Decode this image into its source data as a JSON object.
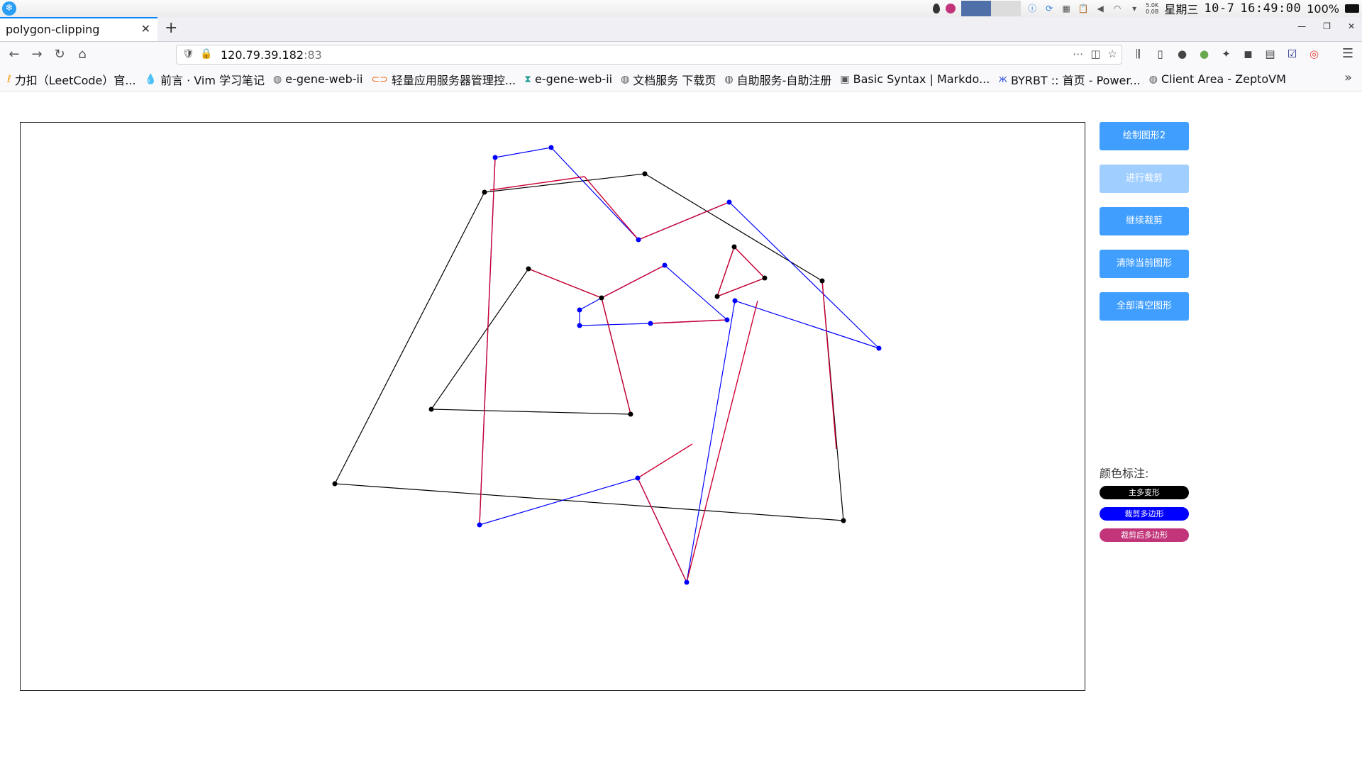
{
  "system_bar": {
    "launcher_icon": "kde-launcher-icon",
    "weekday": "星期三",
    "date": "10-7",
    "time": "16:49:00",
    "battery": "100%",
    "net_up": "5.0K",
    "net_down": "0.0B"
  },
  "browser": {
    "tab_title": "polygon-clipping",
    "url_host": "120.79.39.182",
    "url_port": ":83",
    "bookmarks": [
      {
        "label": "力扣（LeetCode）官...",
        "icon": "leetcode-icon"
      },
      {
        "label": "前言 · Vim 学习笔记",
        "icon": "drop-icon"
      },
      {
        "label": "e-gene-web-ii",
        "icon": "globe-icon"
      },
      {
        "label": "轻量应用服务器管理控...",
        "icon": "cloud-icon"
      },
      {
        "label": "e-gene-web-ii",
        "icon": "dna-icon"
      },
      {
        "label": "文档服务 下载页",
        "icon": "globe-icon"
      },
      {
        "label": "自助服务-自助注册",
        "icon": "globe-icon"
      },
      {
        "label": "Basic Syntax | Markdo...",
        "icon": "markdown-icon"
      },
      {
        "label": "BYRBT :: 首页 - Power...",
        "icon": "butterfly-icon"
      },
      {
        "label": "Client Area - ZeptoVM",
        "icon": "globe-icon"
      }
    ]
  },
  "controls": {
    "draw_shape2": "绘制图形2",
    "clip": "进行裁剪",
    "continue_clip": "继续裁剪",
    "clear_current": "清除当前图形",
    "clear_all": "全部清空图形"
  },
  "legend": {
    "title": "颜色标注:",
    "items": [
      {
        "label": "主多变形",
        "color": "#000000"
      },
      {
        "label": "裁剪多边形",
        "color": "#0000ff"
      },
      {
        "label": "裁剪后多边形",
        "color": "#c2357a"
      }
    ]
  },
  "colors": {
    "main_polygon": "#000000",
    "clip_polygon": "#0000ff",
    "result_polygon": "#cc0033",
    "accent_button": "#409eff"
  },
  "polygons": {
    "main": [
      [
        654,
        98
      ],
      [
        880,
        72
      ],
      [
        1130,
        223
      ],
      [
        1160,
        561
      ],
      [
        443,
        509
      ],
      [
        654,
        98
      ]
    ],
    "main_inner": [
      [
        716,
        206
      ],
      [
        819,
        247
      ],
      [
        860,
        411
      ],
      [
        579,
        404
      ],
      [
        716,
        206
      ]
    ],
    "main_inner2": [
      [
        1006,
        175
      ],
      [
        1049,
        219
      ],
      [
        982,
        245
      ],
      [
        1006,
        175
      ]
    ],
    "clip": [
      [
        669,
        49
      ],
      [
        748,
        35
      ],
      [
        871,
        165
      ],
      [
        999,
        112
      ],
      [
        1210,
        318
      ],
      [
        1007,
        251
      ],
      [
        939,
        648
      ],
      [
        870,
        501
      ],
      [
        647,
        567
      ],
      [
        669,
        49
      ]
    ],
    "clip_inner": [
      [
        788,
        286
      ],
      [
        807,
        262
      ],
      [
        816,
        283
      ],
      [
        788,
        286
      ]
    ],
    "clip_inner2": [
      [
        908,
        201
      ],
      [
        996,
        278
      ],
      [
        888,
        283
      ],
      [
        788,
        286
      ],
      [
        788,
        264
      ],
      [
        819,
        247
      ],
      [
        908,
        201
      ]
    ],
    "result": [
      [
        [
          662,
          95
        ],
        [
          795,
          76
        ]
      ],
      [
        [
          795,
          76
        ],
        [
          871,
          165
        ],
        [
          999,
          112
        ]
      ],
      [
        [
          1130,
          223
        ],
        [
          1150,
          460
        ]
      ],
      [
        [
          716,
          206
        ],
        [
          819,
          247
        ]
      ],
      [
        [
          819,
          247
        ],
        [
          908,
          201
        ]
      ],
      [
        [
          888,
          283
        ],
        [
          996,
          278
        ]
      ],
      [
        [
          819,
          247
        ],
        [
          860,
          411
        ]
      ],
      [
        [
          669,
          49
        ],
        [
          647,
          567
        ]
      ],
      [
        [
          870,
          501
        ],
        [
          947,
          453
        ]
      ],
      [
        [
          939,
          648
        ],
        [
          870,
          501
        ]
      ],
      [
        [
          1006,
          175
        ],
        [
          1049,
          219
        ],
        [
          982,
          245
        ],
        [
          1006,
          175
        ]
      ],
      [
        [
          1039,
          251
        ],
        [
          939,
          648
        ]
      ]
    ],
    "main_vertices": [
      [
        654,
        98
      ],
      [
        880,
        72
      ],
      [
        1130,
        223
      ],
      [
        1160,
        561
      ],
      [
        443,
        509
      ],
      [
        716,
        206
      ],
      [
        819,
        247
      ],
      [
        860,
        411
      ],
      [
        579,
        404
      ],
      [
        1006,
        175
      ],
      [
        1049,
        219
      ],
      [
        982,
        245
      ]
    ],
    "clip_vertices": [
      [
        669,
        49
      ],
      [
        748,
        35
      ],
      [
        871,
        165
      ],
      [
        999,
        112
      ],
      [
        1210,
        318
      ],
      [
        1007,
        251
      ],
      [
        939,
        648
      ],
      [
        870,
        501
      ],
      [
        647,
        567
      ],
      [
        788,
        286
      ],
      [
        788,
        264
      ],
      [
        908,
        201
      ],
      [
        888,
        283
      ],
      [
        996,
        278
      ]
    ]
  }
}
